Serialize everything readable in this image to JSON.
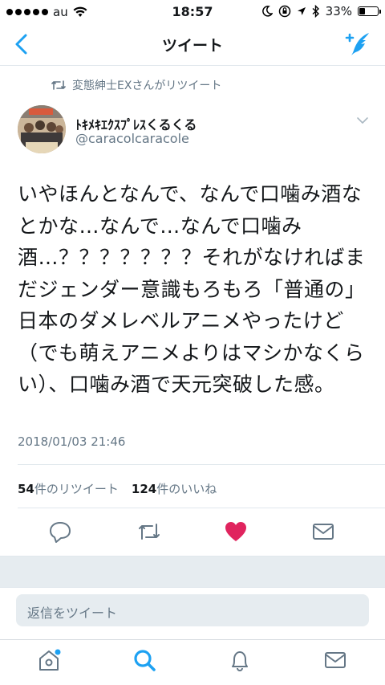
{
  "status_bar": {
    "carrier": "au",
    "time": "18:57",
    "battery_percent": "33%",
    "battery_level": 0.33
  },
  "nav": {
    "title": "ツイート",
    "back_icon": "chevron-left-icon",
    "compose_icon": "compose-tweet-icon"
  },
  "retweet": {
    "label": "変態紳士EXさんがリツイート"
  },
  "author": {
    "name": "ﾄｷﾒｷｴｸｽﾌﾟﾚｽくるくる",
    "handle": "@caracolcaracole"
  },
  "tweet": {
    "text": "いやほんとなんで、なんで口噛み酒なとかな…なんで…なんで口噛み酒…？？？？？？？それがなければまだジェンダー意識もろもろ「普通の」日本のダメレベルアニメやったけど（でも萌えアニメよりはマシかなくらい）、口噛み酒で天元突破した感。",
    "timestamp": "2018/01/03 21:46"
  },
  "stats": {
    "retweets_count": "54",
    "retweets_label": "件のリツイート",
    "likes_count": "124",
    "likes_label": "件のいいね"
  },
  "actions": [
    "reply-icon",
    "retweet-icon",
    "like-icon",
    "direct-message-icon"
  ],
  "reply": {
    "placeholder": "返信をツイート"
  },
  "tabs": [
    "home-icon",
    "search-icon",
    "notifications-icon",
    "messages-icon"
  ],
  "colors": {
    "accent": "#1da1f2",
    "like": "#e0245e",
    "secondary_text": "#657786",
    "divider": "#e1e8ed"
  }
}
